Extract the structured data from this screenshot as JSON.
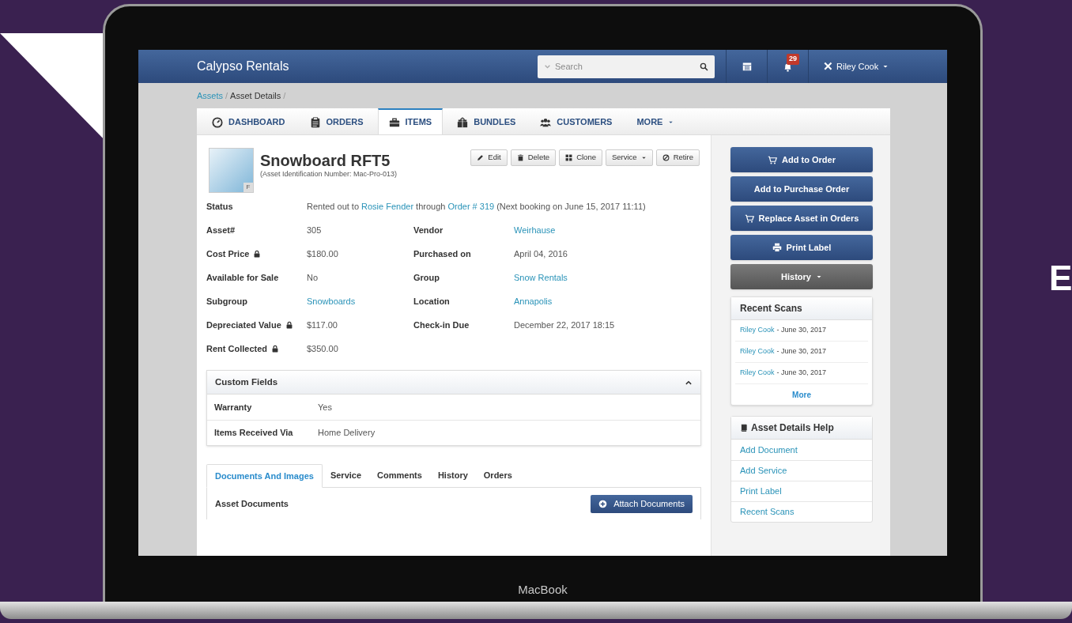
{
  "backdrop": {
    "letter": "E"
  },
  "laptop": {
    "label": "MacBook"
  },
  "header": {
    "app_title": "Calypso Rentals",
    "search": {
      "placeholder": "Search"
    },
    "notification_count": "29",
    "user": "Riley Cook"
  },
  "breadcrumb": {
    "separator": "/",
    "items": [
      {
        "label": "Assets",
        "link": true
      },
      {
        "label": "Asset Details",
        "link": false
      }
    ]
  },
  "nav_tabs": [
    {
      "label": "DASHBOARD",
      "selected": false,
      "dropdown": false
    },
    {
      "label": "ORDERS",
      "selected": false,
      "dropdown": false
    },
    {
      "label": "ITEMS",
      "selected": true,
      "dropdown": false
    },
    {
      "label": "BUNDLES",
      "selected": false,
      "dropdown": false
    },
    {
      "label": "CUSTOMERS",
      "selected": false,
      "dropdown": false
    },
    {
      "label": "MORE",
      "selected": false,
      "dropdown": true
    }
  ],
  "asset": {
    "title": "Snowboard RFT5",
    "subtitle": "(Asset Identification Number: Mac-Pro-013)",
    "photo_badge": "F",
    "actions": [
      {
        "label": "Edit",
        "dropdown": false
      },
      {
        "label": "Delete",
        "dropdown": false
      },
      {
        "label": "Clone",
        "dropdown": false
      },
      {
        "label": "Service",
        "dropdown": true
      },
      {
        "label": "Retire",
        "dropdown": false
      }
    ],
    "status": {
      "label": "Status",
      "parts": [
        {
          "text": "Rented out to",
          "link": false
        },
        {
          "text": "Rosie Fender",
          "link": true
        },
        {
          "text": "through",
          "link": false
        },
        {
          "text": "Order # 319",
          "link": true
        },
        {
          "text": "(Next booking on June 15, 2017 11:11)",
          "link": false
        }
      ]
    },
    "rows": [
      [
        {
          "label": "Asset#",
          "locked": false,
          "value": "305",
          "link": false
        },
        {
          "label": "Vendor",
          "locked": false,
          "value": "Weirhause",
          "link": true
        }
      ],
      [
        {
          "label": "Cost Price",
          "locked": true,
          "value": "$180.00",
          "link": false
        },
        {
          "label": "Purchased on",
          "locked": false,
          "value": "April 04, 2016",
          "link": false
        }
      ],
      [
        {
          "label": "Available for Sale",
          "locked": false,
          "value": "No",
          "link": false
        },
        {
          "label": "Group",
          "locked": false,
          "value": "Snow Rentals",
          "link": true
        }
      ],
      [
        {
          "label": "Subgroup",
          "locked": false,
          "value": "Snowboards",
          "link": true
        },
        {
          "label": "Location",
          "locked": false,
          "value": "Annapolis",
          "link": true
        }
      ],
      [
        {
          "label": "Depreciated Value",
          "locked": true,
          "value": "$117.00",
          "link": false
        },
        {
          "label": "Check-in Due",
          "locked": false,
          "value": "December 22, 2017 18:15",
          "link": false
        }
      ],
      [
        {
          "label": "Rent Collected",
          "locked": true,
          "value": "$350.00",
          "link": false
        }
      ]
    ]
  },
  "custom_fields": {
    "title": "Custom Fields",
    "expanded": true,
    "rows": [
      {
        "label": "Warranty",
        "value": "Yes"
      },
      {
        "label": "Items Received Via",
        "value": "Home Delivery"
      }
    ]
  },
  "detail_tabs": [
    {
      "label": "Documents And Images",
      "selected": true
    },
    {
      "label": "Service",
      "selected": false
    },
    {
      "label": "Comments",
      "selected": false
    },
    {
      "label": "History",
      "selected": false
    },
    {
      "label": "Orders",
      "selected": false
    }
  ],
  "documents": {
    "title": "Asset Documents",
    "button": "Attach Documents"
  },
  "side_actions": [
    {
      "label": "Add to Order",
      "kind": "primary",
      "dropdown": false
    },
    {
      "label": "Add to Purchase Order",
      "kind": "primary",
      "dropdown": false
    },
    {
      "label": "Replace Asset in Orders",
      "kind": "primary",
      "dropdown": false
    },
    {
      "label": "Print Label",
      "kind": "primary",
      "dropdown": false
    },
    {
      "label": "History",
      "kind": "secondary",
      "dropdown": true
    }
  ],
  "recent_scans": {
    "title": "Recent Scans",
    "items": [
      {
        "user": "Riley Cook",
        "date": "- June 30, 2017"
      },
      {
        "user": "Riley Cook",
        "date": "- June 30, 2017"
      },
      {
        "user": "Riley Cook",
        "date": "- June 30, 2017"
      }
    ],
    "more": "More"
  },
  "help": {
    "title": "Asset Details Help",
    "links": [
      "Add Document",
      "Add Service",
      "Print Label",
      "Recent Scans"
    ]
  }
}
